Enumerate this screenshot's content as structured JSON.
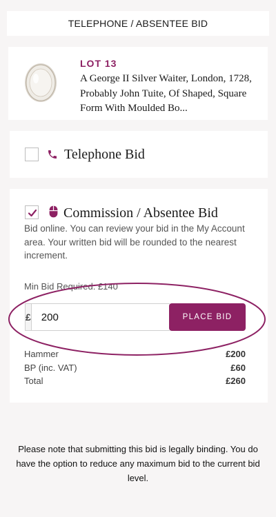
{
  "header": {
    "title": "TELEPHONE / ABSENTEE BID"
  },
  "lot": {
    "label": "LOT 13",
    "description": "A George II Silver Waiter, London, 1728, Probably John Tuite, Of Shaped, Square Form With Moulded Bo..."
  },
  "telephone_bid": {
    "label": "Telephone Bid",
    "checked": false,
    "icon": "phone-icon"
  },
  "commission_bid": {
    "label": "Commission / Absentee Bid",
    "checked": true,
    "icon": "mouse-icon",
    "info": "Bid online. You can review your bid in the My Account area. Your written bid will be rounded to the nearest increment.",
    "min_bid_label": "Min Bid Required: £140",
    "currency": "£",
    "amount": "200",
    "button_label": "PLACE BID",
    "totals": [
      {
        "label": "Hammer",
        "value": "£200"
      },
      {
        "label": "BP (inc. VAT)",
        "value": "£60"
      },
      {
        "label": "Total",
        "value": "£260"
      }
    ]
  },
  "footer": {
    "note": "Please note that submitting this bid is legally binding. You do have the option to reduce any maximum bid to the current bid level."
  },
  "colors": {
    "accent": "#8d2163",
    "background": "#f7f5f5"
  }
}
